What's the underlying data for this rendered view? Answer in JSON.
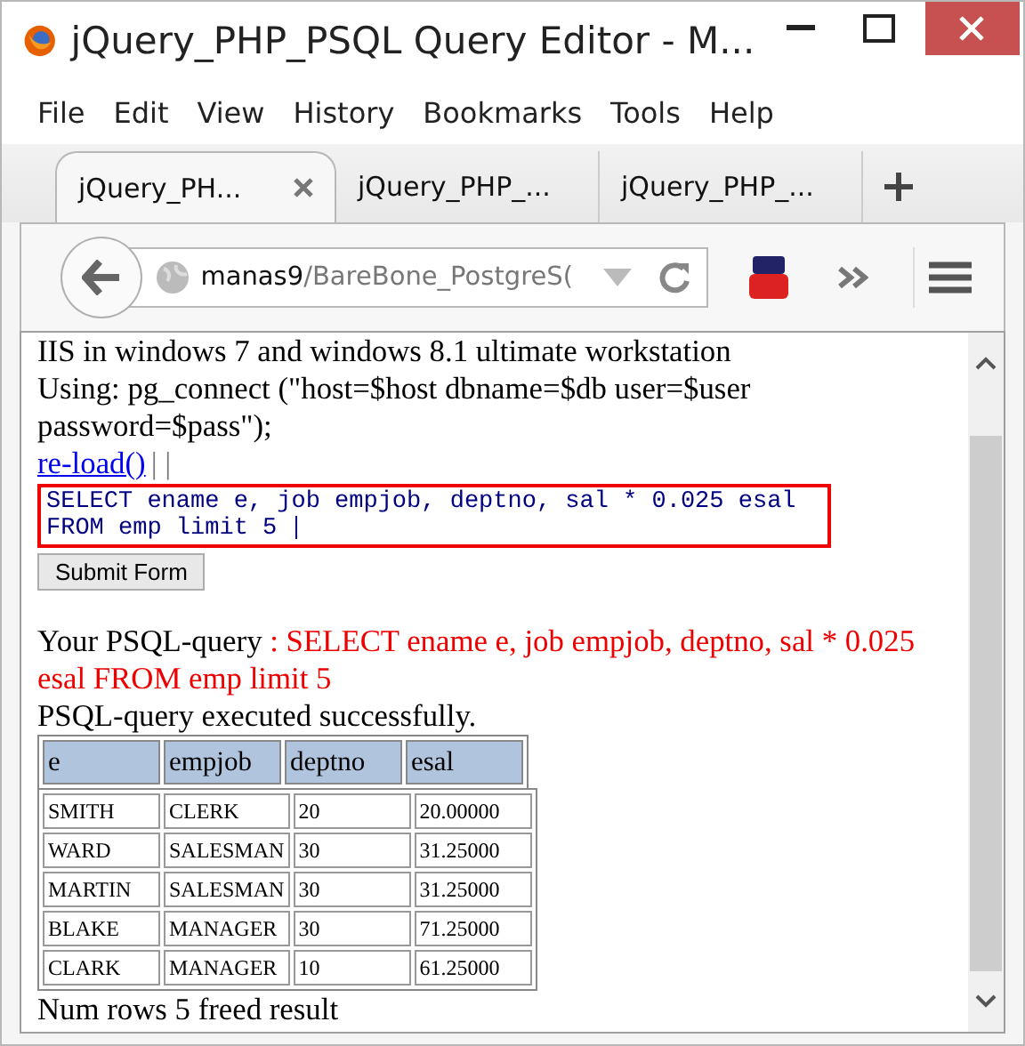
{
  "window": {
    "title": "jQuery_PHP_PSQL Query Editor - M..."
  },
  "menu": [
    "File",
    "Edit",
    "View",
    "History",
    "Bookmarks",
    "Tools",
    "Help"
  ],
  "tabs": [
    {
      "label": "jQuery_PH...",
      "selected": true
    },
    {
      "label": "jQuery_PHP_...",
      "selected": false
    },
    {
      "label": "jQuery_PHP_...",
      "selected": false
    }
  ],
  "address": {
    "host": "manas9",
    "path": "/BareBone_PostgreS("
  },
  "page": {
    "lines": [
      "IIS in windows 7 and windows 8.1 ultimate workstation",
      "Using: pg_connect (\"host=$host dbname=$db user=$user password=$pass\");"
    ],
    "link": "re-load()",
    "separator": "| |",
    "query": "SELECT ename e, job empjob, deptno, sal * 0.025 esal FROM emp limit 5 ",
    "submit": "Submit Form",
    "result_label": "Your PSQL-query ",
    "result_query": ": SELECT ename e, job empjob, deptno, sal * 0.025 esal FROM emp limit 5",
    "status": "PSQL-query executed successfully.",
    "table": {
      "columns": [
        "e",
        "empjob",
        "deptno",
        "esal"
      ],
      "rows": [
        [
          "SMITH",
          "CLERK",
          "20",
          "20.00000"
        ],
        [
          "WARD",
          "SALESMAN",
          "30",
          "31.25000"
        ],
        [
          "MARTIN",
          "SALESMAN",
          "30",
          "31.25000"
        ],
        [
          "BLAKE",
          "MANAGER",
          "30",
          "71.25000"
        ],
        [
          "CLARK",
          "MANAGER",
          "10",
          "61.25000"
        ]
      ]
    },
    "footer": "Num rows 5 freed result"
  }
}
